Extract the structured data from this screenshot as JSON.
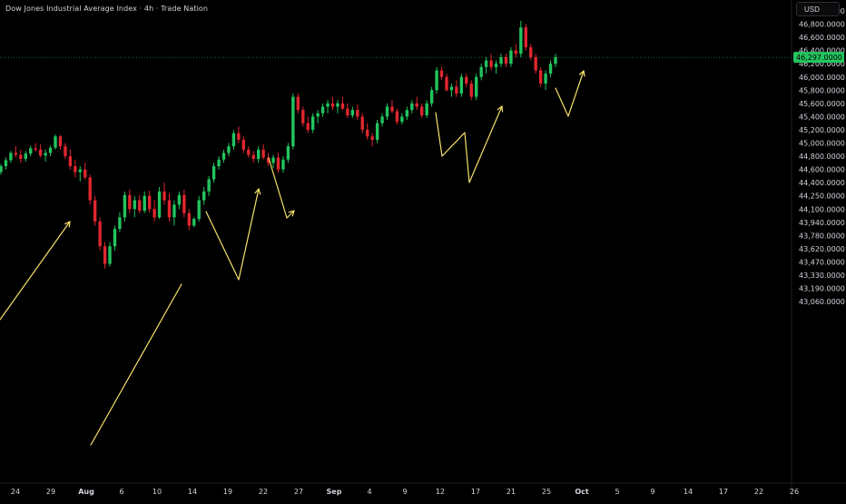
{
  "header": {
    "title": "Dow Jones Industrial Average Index · 4h · Trade Nation",
    "currency": "USD"
  },
  "colors": {
    "background": "#000000",
    "up": "#22c55e",
    "down": "#e0262e",
    "drawing": "#f7e36b",
    "price_line": "#1e8e4e",
    "price_tag": "#22c55e",
    "axis_text": "#d1d4dc"
  },
  "current_price": {
    "label": "46,297.0000",
    "value": 46297
  },
  "chart_data": {
    "type": "candlestick",
    "y_axis_ticks": [
      "47,000.0000",
      "46,800.0000",
      "46,600.0000",
      "46,400.0000",
      "46,200.0000",
      "46,000.0000",
      "45,800.0000",
      "45,600.0000",
      "45,400.0000",
      "45,200.0000",
      "45,000.0000",
      "44,800.0000",
      "44,600.0000",
      "44,400.0000",
      "44,250.0000",
      "44,100.0000",
      "43,940.0000",
      "43,780.0000",
      "43,620.0000",
      "43,470.0000",
      "43,330.0000",
      "43,190.0000",
      "43,060.0000"
    ],
    "x_axis_ticks": [
      "24",
      "29",
      "Aug",
      "6",
      "10",
      "14",
      "19",
      "22",
      "27",
      "Sep",
      "4",
      "9",
      "12",
      "17",
      "21",
      "25",
      "Oct",
      "5",
      "9",
      "14",
      "17",
      "22",
      "26"
    ],
    "x_axis_bold": [
      "Aug",
      "Sep",
      "Oct"
    ],
    "grid": false,
    "series": [
      {
        "values": [
          [
            44560,
            44680,
            44520,
            44650
          ],
          [
            44650,
            44780,
            44600,
            44740
          ],
          [
            44740,
            44880,
            44700,
            44850
          ],
          [
            44850,
            44950,
            44780,
            44820
          ],
          [
            44820,
            44900,
            44700,
            44760
          ],
          [
            44760,
            44880,
            44720,
            44840
          ],
          [
            44840,
            44960,
            44800,
            44920
          ],
          [
            44920,
            45000,
            44870,
            44900
          ],
          [
            44900,
            44980,
            44780,
            44810
          ],
          [
            44810,
            44900,
            44720,
            44850
          ],
          [
            44850,
            44960,
            44800,
            44930
          ],
          [
            44930,
            45130,
            44900,
            45100
          ],
          [
            45100,
            45120,
            44900,
            44950
          ],
          [
            44950,
            45000,
            44760,
            44800
          ],
          [
            44800,
            44900,
            44600,
            44650
          ],
          [
            44650,
            44750,
            44480,
            44560
          ],
          [
            44560,
            44650,
            44420,
            44600
          ],
          [
            44600,
            44700,
            44450,
            44480
          ],
          [
            44480,
            44520,
            44150,
            44200
          ],
          [
            44200,
            44250,
            43900,
            43950
          ],
          [
            43950,
            44000,
            43600,
            43650
          ],
          [
            43650,
            43700,
            43400,
            43450
          ],
          [
            43450,
            43700,
            43420,
            43650
          ],
          [
            43650,
            43900,
            43600,
            43860
          ],
          [
            43860,
            44060,
            43820,
            44000
          ],
          [
            44000,
            44300,
            43950,
            44260
          ],
          [
            44260,
            44320,
            44050,
            44100
          ],
          [
            44100,
            44250,
            44000,
            44200
          ],
          [
            44200,
            44260,
            44050,
            44080
          ],
          [
            44080,
            44300,
            44050,
            44250
          ],
          [
            44250,
            44310,
            44060,
            44100
          ],
          [
            44100,
            44200,
            43950,
            44000
          ],
          [
            44000,
            44350,
            43980,
            44300
          ],
          [
            44300,
            44400,
            44150,
            44200
          ],
          [
            44200,
            44280,
            43950,
            44000
          ],
          [
            44000,
            44200,
            43900,
            44150
          ],
          [
            44150,
            44300,
            44100,
            44260
          ],
          [
            44260,
            44320,
            44000,
            44050
          ],
          [
            44050,
            44100,
            43850,
            43900
          ],
          [
            43900,
            44000,
            43880,
            43980
          ],
          [
            43980,
            44250,
            43950,
            44200
          ],
          [
            44200,
            44350,
            44150,
            44300
          ],
          [
            44300,
            44500,
            44250,
            44450
          ],
          [
            44450,
            44700,
            44400,
            44650
          ],
          [
            44650,
            44800,
            44600,
            44750
          ],
          [
            44750,
            44900,
            44700,
            44850
          ],
          [
            44850,
            45000,
            44800,
            44950
          ],
          [
            44950,
            45200,
            44900,
            45150
          ],
          [
            45150,
            45250,
            45000,
            45050
          ],
          [
            45050,
            45100,
            44850,
            44900
          ],
          [
            44900,
            44950,
            44780,
            44820
          ],
          [
            44820,
            44880,
            44700,
            44760
          ],
          [
            44760,
            44950,
            44700,
            44900
          ],
          [
            44900,
            44980,
            44750,
            44780
          ],
          [
            44780,
            44850,
            44650,
            44700
          ],
          [
            44700,
            44820,
            44620,
            44780
          ],
          [
            44780,
            44850,
            44550,
            44600
          ],
          [
            44600,
            44800,
            44550,
            44750
          ],
          [
            44750,
            45000,
            44700,
            44950
          ],
          [
            44950,
            45750,
            44900,
            45700
          ],
          [
            45700,
            45750,
            45450,
            45500
          ],
          [
            45500,
            45550,
            45250,
            45300
          ],
          [
            45300,
            45400,
            45150,
            45200
          ],
          [
            45200,
            45450,
            45150,
            45400
          ],
          [
            45400,
            45500,
            45300,
            45450
          ],
          [
            45450,
            45600,
            45400,
            45550
          ],
          [
            45550,
            45650,
            45450,
            45600
          ],
          [
            45600,
            45700,
            45500,
            45550
          ],
          [
            45550,
            45650,
            45450,
            45600
          ],
          [
            45600,
            45700,
            45500,
            45520
          ],
          [
            45520,
            45600,
            45380,
            45420
          ],
          [
            45420,
            45550,
            45380,
            45500
          ],
          [
            45500,
            45580,
            45350,
            45400
          ],
          [
            45400,
            45450,
            45150,
            45200
          ],
          [
            45200,
            45300,
            45050,
            45100
          ],
          [
            45100,
            45150,
            44950,
            45050
          ],
          [
            45050,
            45350,
            45000,
            45300
          ],
          [
            45300,
            45450,
            45250,
            45400
          ],
          [
            45400,
            45600,
            45350,
            45550
          ],
          [
            45550,
            45650,
            45450,
            45480
          ],
          [
            45480,
            45520,
            45280,
            45320
          ],
          [
            45320,
            45450,
            45280,
            45400
          ],
          [
            45400,
            45550,
            45350,
            45500
          ],
          [
            45500,
            45650,
            45450,
            45600
          ],
          [
            45600,
            45700,
            45500,
            45550
          ],
          [
            45550,
            45600,
            45380,
            45420
          ],
          [
            45420,
            45650,
            45380,
            45600
          ],
          [
            45600,
            45850,
            45550,
            45800
          ],
          [
            45800,
            46150,
            45750,
            46100
          ],
          [
            46100,
            46150,
            45950,
            46000
          ],
          [
            46000,
            46050,
            45780,
            45800
          ],
          [
            45800,
            45900,
            45700,
            45850
          ],
          [
            45850,
            45950,
            45700,
            45750
          ],
          [
            45750,
            46050,
            45700,
            46000
          ],
          [
            46000,
            46050,
            45850,
            45900
          ],
          [
            45900,
            45950,
            45650,
            45700
          ],
          [
            45700,
            46050,
            45650,
            46000
          ],
          [
            46000,
            46200,
            45950,
            46150
          ],
          [
            46150,
            46300,
            46050,
            46250
          ],
          [
            46250,
            46350,
            46100,
            46150
          ],
          [
            46150,
            46250,
            46050,
            46200
          ],
          [
            46200,
            46350,
            46150,
            46300
          ],
          [
            46300,
            46350,
            46150,
            46200
          ],
          [
            46200,
            46450,
            46150,
            46400
          ],
          [
            46400,
            46500,
            46300,
            46350
          ],
          [
            46350,
            46850,
            46300,
            46750
          ],
          [
            46750,
            46800,
            46400,
            46450
          ],
          [
            46450,
            46500,
            46250,
            46300
          ],
          [
            46300,
            46350,
            46050,
            46100
          ],
          [
            46100,
            46150,
            45850,
            45900
          ],
          [
            45900,
            46100,
            45800,
            46050
          ],
          [
            46050,
            46250,
            46000,
            46200
          ],
          [
            46200,
            46350,
            46150,
            46297
          ]
        ]
      }
    ],
    "drawings": {
      "type": "hand-drawn projection zigzags",
      "color": "#f7e36b"
    }
  }
}
